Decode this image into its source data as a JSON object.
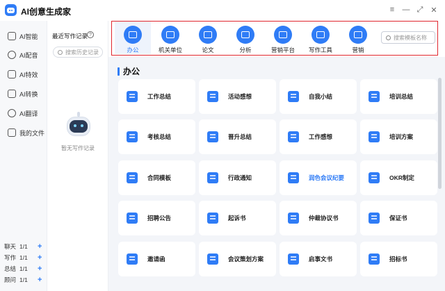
{
  "app": {
    "title": "AI创意生成家"
  },
  "window_controls": {
    "menu": "≡",
    "minimize": "—",
    "maximize": "⤢",
    "close": "✕"
  },
  "sidebar": {
    "items": [
      {
        "label": "AI智能",
        "icon": "robot-icon"
      },
      {
        "label": "AI配音",
        "icon": "mic-icon"
      },
      {
        "label": "AI特效",
        "icon": "sparkle-icon"
      },
      {
        "label": "AI转换",
        "icon": "convert-icon"
      },
      {
        "label": "AI翻译",
        "icon": "translate-icon"
      },
      {
        "label": "我的文件",
        "icon": "folder-icon"
      }
    ],
    "counts": [
      {
        "label": "聊天",
        "value": "1/1",
        "plus": "+"
      },
      {
        "label": "写作",
        "value": "1/1",
        "plus": "+"
      },
      {
        "label": "总结",
        "value": "1/1",
        "plus": "+"
      },
      {
        "label": "顾问",
        "value": "1/1",
        "plus": "+"
      }
    ]
  },
  "history": {
    "title": "最近写作记录",
    "help": "?",
    "search_placeholder": "搜索历史记录",
    "empty_text": "暂无写作记录"
  },
  "categories": {
    "items": [
      {
        "label": "办公",
        "icon": "briefcase-icon",
        "active": true
      },
      {
        "label": "机关单位",
        "icon": "lock-icon"
      },
      {
        "label": "论文",
        "icon": "document-icon"
      },
      {
        "label": "分析",
        "icon": "chart-icon"
      },
      {
        "label": "营销平台",
        "icon": "marketing-icon"
      },
      {
        "label": "写作工具",
        "icon": "pen-icon"
      },
      {
        "label": "营销",
        "icon": "target-icon"
      }
    ],
    "search_placeholder": "搜索模板名称",
    "highlight_color": "#e0262e",
    "accent_color": "#2f7cf6"
  },
  "section": {
    "title": "办公"
  },
  "templates": [
    "工作总结",
    "活动感想",
    "自我小结",
    "培训总结",
    "考核总结",
    "晋升总结",
    "工作感想",
    "培训方案",
    "合同模板",
    "行政通知",
    "润色会议纪要",
    "OKR制定",
    "招聘公告",
    "起诉书",
    "仲裁协议书",
    "保证书",
    "邀请函",
    "会议策划方案",
    "启事文书",
    "招标书"
  ]
}
